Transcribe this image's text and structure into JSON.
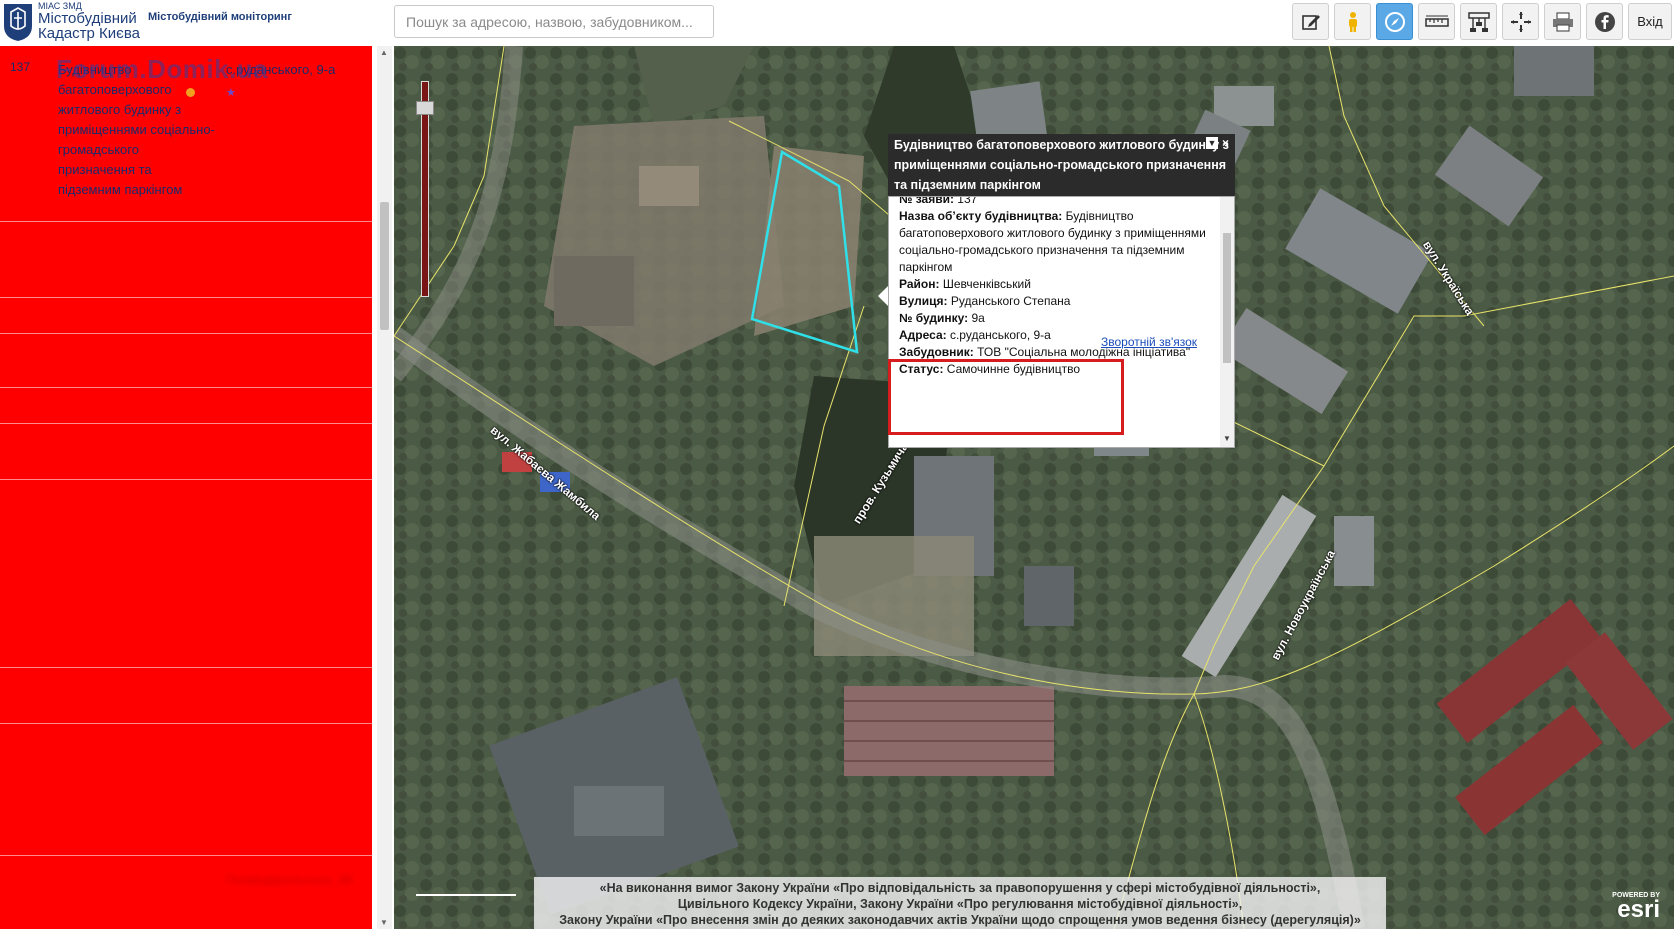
{
  "header": {
    "logo_small": "МІАС ЗМД",
    "logo_line1": "Містобудівний",
    "logo_line2": "Кадастр Києва",
    "title": "Містобудівний моніторинг",
    "search_placeholder": "Пошук за адресою, назвою, забудовником...",
    "toolbar": [
      {
        "name": "edit-icon"
      },
      {
        "name": "streetview-person-icon"
      },
      {
        "name": "compass-icon",
        "active": true
      },
      {
        "name": "measure-ruler-icon"
      },
      {
        "name": "layers-tree-icon"
      },
      {
        "name": "crosshair-icon"
      },
      {
        "name": "printer-icon"
      },
      {
        "name": "facebook-icon"
      }
    ],
    "exit_label": "Вхід"
  },
  "list": {
    "watermark": "Forum.Domik.ua",
    "rows": [
      {
        "num": "137",
        "name": "Будівництво багатоповерхового житлового будинку з приміщеннями соціально-громадського призначення та підземним паркінгом",
        "addr": "с.руданського, 9-а"
      },
      {
        "num": "",
        "name": "",
        "addr": ""
      },
      {
        "num": "",
        "name": "",
        "addr": ""
      },
      {
        "num": "",
        "name": "",
        "addr": ""
      },
      {
        "num": "",
        "name": "",
        "addr": ""
      },
      {
        "num": "",
        "name": "",
        "addr": ""
      },
      {
        "num": "",
        "name": "",
        "addr": ""
      },
      {
        "num": "",
        "name": "",
        "addr": ""
      },
      {
        "num": "",
        "name": "",
        "addr": ""
      },
      {
        "num": "",
        "name": "",
        "addr": "Потвіндірольська, 28"
      }
    ]
  },
  "map": {
    "streets": [
      "вул. Жабаєва Жамбила",
      "пров. Кузьмича",
      "вул. Україська",
      "вул. Новоукраїнська"
    ],
    "popup": {
      "title": "Будівництво багатоповерхового житлового будинку з приміщеннями соціально-громадського призначення та підземним паркінгом",
      "number_label": "№ заяви:",
      "number_value": "137",
      "name_label": "Назва об’єкту будівництва:",
      "name_value": "Будівництво багатоповерхового житлового будинку з приміщеннями соціально-громадського призначення та підземним паркінгом",
      "district_label": "Район:",
      "district_value": "Шевченківський",
      "street_label": "Вулиця:",
      "street_value": "Руданського Степана",
      "building_label": "№ будинку:",
      "building_value": "9а",
      "address_label": "Адреса:",
      "address_value": "с.руданського, 9-а",
      "developer_label": "Забудовник:",
      "developer_value": "ТОВ \"Соціальна молодіжна ініціатива\"",
      "status_label": "Статус:",
      "status_value": "Самочинне будівництво",
      "feedback_link": "Зворотній зв'язок"
    },
    "legal": [
      "«На виконання вимог Закону України «Про відповідальність за правопорушення у сфері містобудівної діяльності»,",
      "Цивільного Кодексу України, Закону України «Про регулювання містобудівної діяльності»,",
      "Закону України «Про внесення змін до деяких законодавчих актів України щодо спрощення умов ведення бізнесу (дерегуляція)»"
    ],
    "esri_small": "POWERED BY",
    "esri_big": "esri"
  },
  "colors": {
    "list_bg": "#ff0000",
    "highlight_box": "#d61c1c",
    "parcel_outline": "#2fe0e8",
    "road_lines": "#e8e36a",
    "active_tool": "#5aa9e6"
  }
}
